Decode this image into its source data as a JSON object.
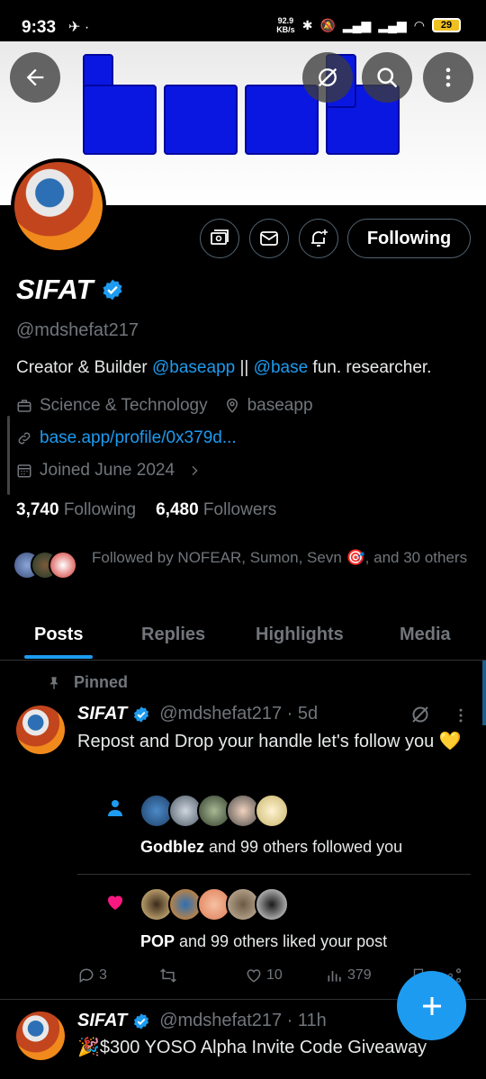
{
  "status_bar": {
    "time": "9:33",
    "net_speed_value": "92.9",
    "net_speed_unit": "KB/s",
    "battery": "29"
  },
  "profile": {
    "name": "SIFAT",
    "handle": "@mdshefat217",
    "bio_prefix": "Creator & Builder ",
    "bio_link1": "@baseapp",
    "bio_mid": " || ",
    "bio_link2": "@base",
    "bio_suffix": " fun.  researcher.",
    "category": "Science & Technology",
    "location": "baseapp",
    "website": "base.app/profile/0x379d...",
    "joined": "Joined June 2024",
    "following_count": "3,740",
    "following_label": "Following",
    "followers_count": "6,480",
    "followers_label": "Followers",
    "followed_by": "Followed by NOFEAR, Sumon, Sevn 🎯, and 30 others",
    "follow_button": "Following"
  },
  "tabs": [
    {
      "label": "Posts"
    },
    {
      "label": "Replies"
    },
    {
      "label": "Highlights"
    },
    {
      "label": "Media"
    }
  ],
  "pinned_post": {
    "pinned_label": "Pinned",
    "author": "SIFAT",
    "handle_time": "@mdshefat217 · 5d",
    "text": "Repost and Drop your handle let's follow you 💛",
    "follow_notice": {
      "bold": "Godblez",
      "rest": " and 99 others followed you"
    },
    "like_notice": {
      "bold": "POP",
      "rest": " and 99 others liked your post"
    },
    "replies": "3",
    "likes": "10",
    "views": "379"
  },
  "second_post": {
    "author": "SIFAT",
    "handle_time": "@mdshefat217 · 11h",
    "text": "🎉$300 YOSO Alpha Invite Code Giveaway"
  },
  "colors": {
    "accent": "#1d9bf0",
    "background": "#000000",
    "muted": "#71767b",
    "like_pink": "#f91880",
    "banner_blue": "#0a17e0"
  }
}
